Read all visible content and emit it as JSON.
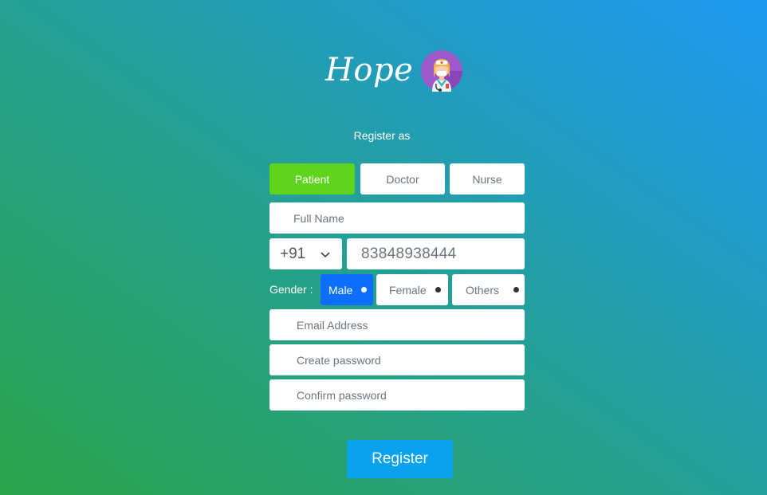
{
  "brand": {
    "name": "Hope"
  },
  "register_as_label": "Register as",
  "roles": [
    {
      "label": "Patient",
      "selected": true
    },
    {
      "label": "Doctor",
      "selected": false
    },
    {
      "label": "Nurse",
      "selected": false
    }
  ],
  "form": {
    "full_name_placeholder": "Full Name",
    "country_code": "+91",
    "phone_value": "83848938444",
    "gender_label": "Gender :",
    "gender_options": [
      {
        "label": "Male",
        "selected": true
      },
      {
        "label": "Female",
        "selected": false
      },
      {
        "label": "Others",
        "selected": false
      }
    ],
    "email_placeholder": "Email Address",
    "create_password_placeholder": "Create password",
    "confirm_password_placeholder": "Confirm password"
  },
  "register_button_label": "Register",
  "colors": {
    "selected_role": "#5fd41d",
    "selected_gender": "#0d6efd",
    "register_button": "#0aa2ec"
  },
  "icons": {
    "avatar": "doctor-avatar-icon",
    "dropdown": "chevron-down-icon"
  }
}
